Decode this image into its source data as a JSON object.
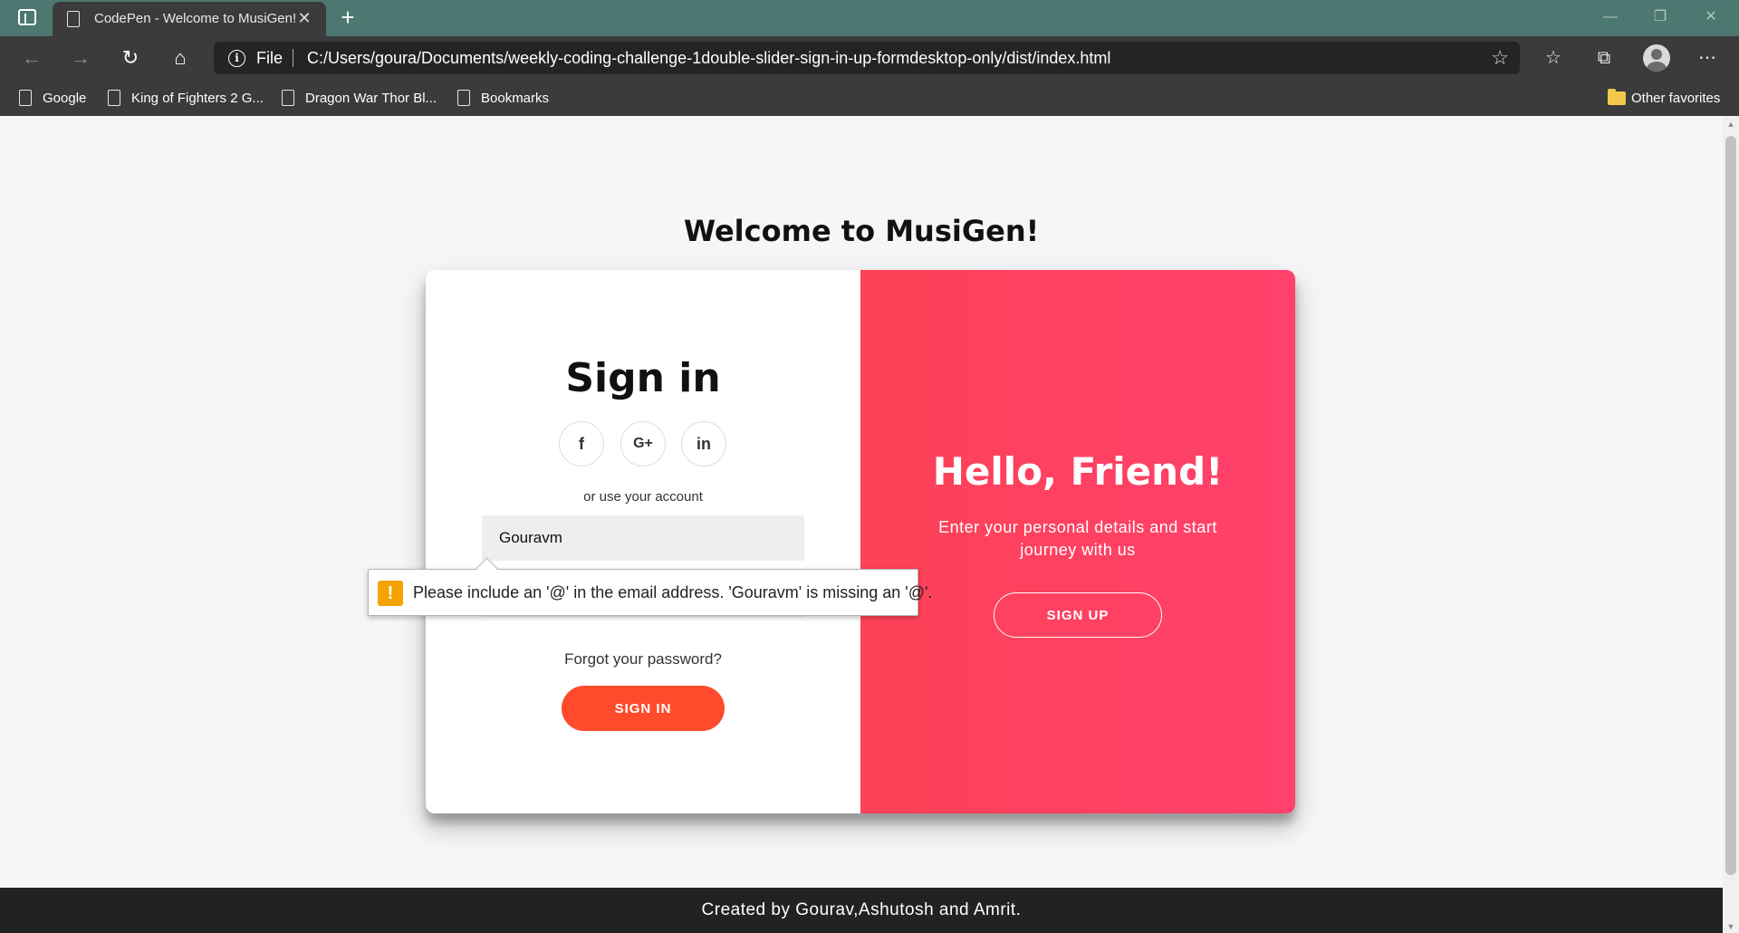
{
  "browser": {
    "tab": {
      "title": "CodePen - Welcome to MusiGen!",
      "close": "✕"
    },
    "new_tab": "+",
    "address": {
      "scheme": "File",
      "url": "C:/Users/goura/Documents/weekly-coding-challenge-1double-slider-sign-in-up-formdesktop-only/dist/index.html"
    },
    "bookmarks": [
      {
        "label": "Google"
      },
      {
        "label": "King of Fighters 2 G..."
      },
      {
        "label": "Dragon War Thor Bl..."
      },
      {
        "label": "Bookmarks"
      }
    ],
    "other_favorites": "Other favorites",
    "window_buttons": {
      "minimize": "—",
      "restore": "❐",
      "close": "✕"
    }
  },
  "page": {
    "heading": "Welcome to MusiGen!",
    "signin": {
      "title": "Sign in",
      "social": [
        {
          "icon": "facebook-icon",
          "glyph": "f"
        },
        {
          "icon": "google-plus-icon",
          "glyph": "G+"
        },
        {
          "icon": "linkedin-icon",
          "glyph": "in"
        }
      ],
      "or_text": "or use your account",
      "email_value": "Gouravm",
      "forgot": "Forgot your password?",
      "button": "SIGN IN"
    },
    "overlay": {
      "title": "Hello, Friend!",
      "subtitle": "Enter your personal details and start journey with us",
      "button": "SIGN UP"
    },
    "validation_tooltip": {
      "icon": "!",
      "message": "Please include an '@' in the email address. 'Gouravm' is missing an '@'."
    },
    "footer": "Created by Gourav,Ashutosh and Amrit."
  },
  "colors": {
    "tabbar": "#4d7771",
    "signin_button": "#ff4b2b",
    "overlay": "#fd4156",
    "warning": "#f5a300"
  }
}
